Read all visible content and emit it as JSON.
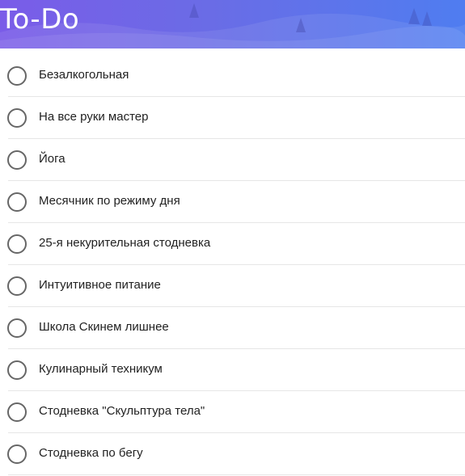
{
  "app": {
    "title": "To-Do"
  },
  "tasks": [
    {
      "label": "Безалкогольная",
      "completed": false
    },
    {
      "label": "На все руки мастер",
      "completed": false
    },
    {
      "label": "Йога",
      "completed": false
    },
    {
      "label": "Месячник по режиму дня",
      "completed": false
    },
    {
      "label": "25-я некурительная стодневка",
      "completed": false
    },
    {
      "label": "Интуитивное питание",
      "completed": false
    },
    {
      "label": "Школа Скинем лишнее",
      "completed": false
    },
    {
      "label": "Кулинарный техникум",
      "completed": false
    },
    {
      "label": "Стодневка \"Скульптура тела\"",
      "completed": false
    },
    {
      "label": "Стодневка по бегу",
      "completed": false
    }
  ],
  "colors": {
    "header_gradient_start": "#7a5ce8",
    "header_gradient_end": "#4f7df0",
    "checkbox_border": "#666666",
    "divider": "#e6e6e6"
  }
}
